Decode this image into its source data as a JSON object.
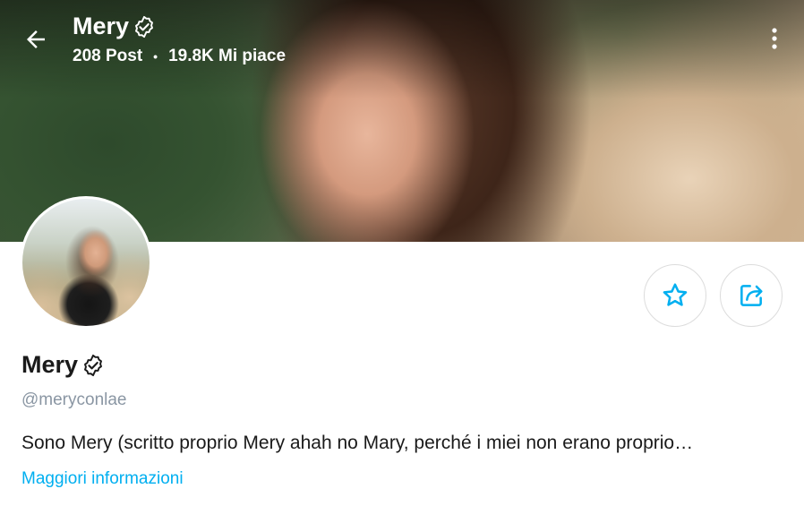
{
  "header": {
    "name": "Mery",
    "posts": "208 Post",
    "likes": "19.8K Mi piace",
    "separator": "•"
  },
  "icons": {
    "back": "arrow-left-icon",
    "more": "vertical-dots-icon",
    "verified": "verified-badge-icon",
    "favorite": "star-icon",
    "share": "share-icon"
  },
  "profile": {
    "name": "Mery",
    "handle": "@meryconlae",
    "bio": "Sono Mery (scritto proprio Mery ahah no Mary, perché i miei non erano proprio…",
    "more_info_label": "Maggiori informazioni"
  },
  "colors": {
    "accent": "#00aff0",
    "muted": "#8a96a3",
    "text": "#1a1a1a"
  }
}
